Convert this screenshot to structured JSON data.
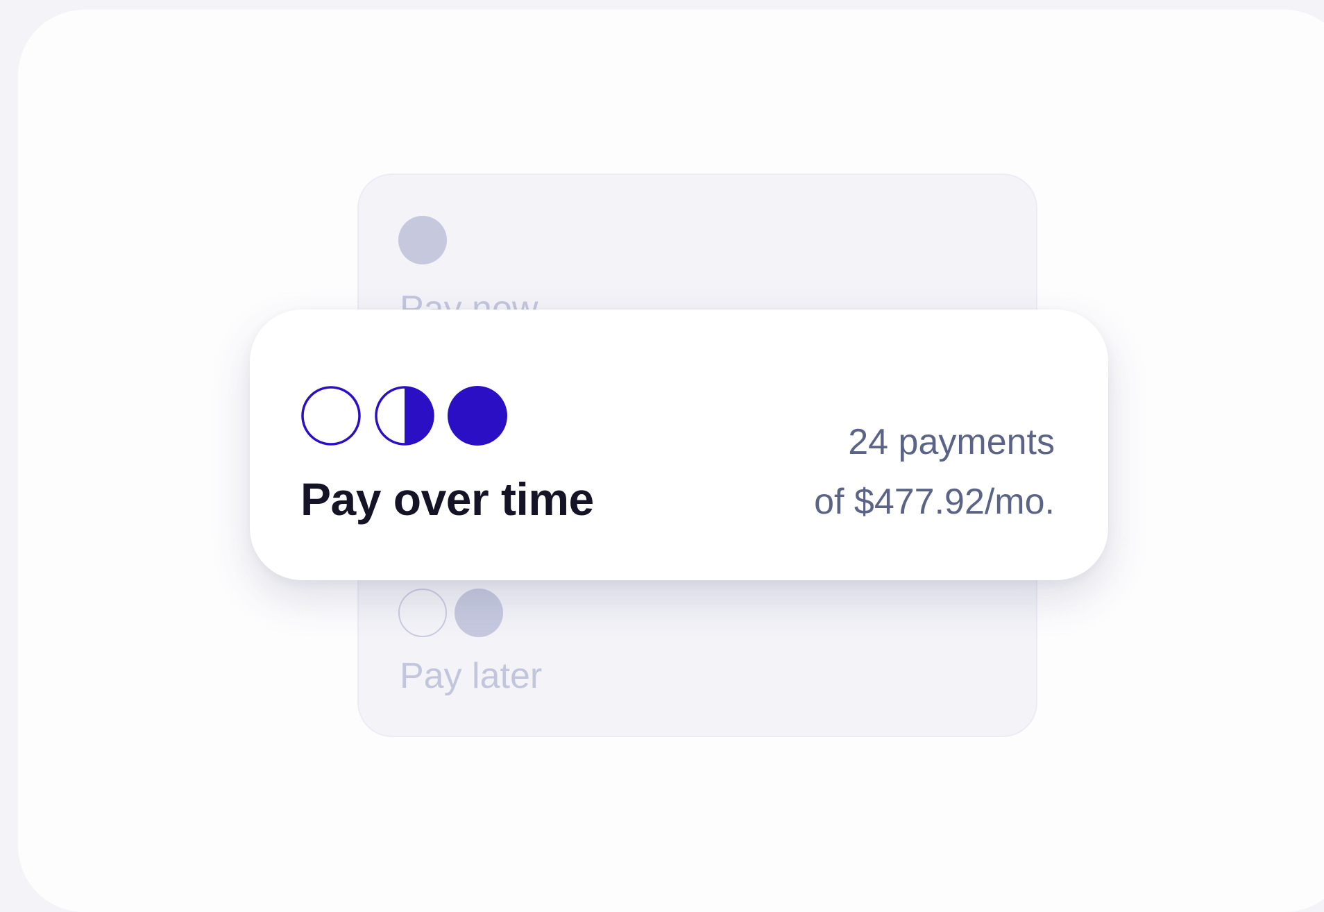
{
  "options": {
    "pay_now": {
      "label": "Pay now",
      "icon": "single-circle-icon"
    },
    "pay_over_time": {
      "label": "Pay over time",
      "detail_line_1": "24 payments",
      "detail_line_2": "of $477.92/mo.",
      "icon": "three-circle-phase-icon"
    },
    "pay_later": {
      "label": "Pay later",
      "icon": "two-circle-icon"
    }
  },
  "colors": {
    "accent": "#2b0fc4",
    "muted_fill": "#c6c9de",
    "muted_text": "#c2c6dc",
    "title_text": "#151427",
    "detail_text": "#5b6386",
    "background": "#f3f3f8"
  }
}
